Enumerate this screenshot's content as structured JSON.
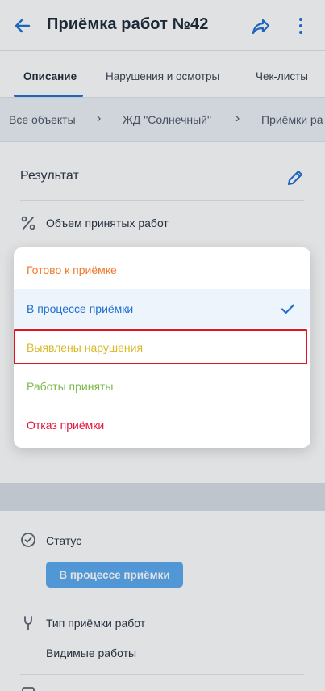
{
  "header": {
    "title": "Приёмка работ №42",
    "icons": {
      "back": "arrow-left-icon",
      "share": "share-icon",
      "more": "more-vertical-icon"
    },
    "accent_color": "#1f6fd1"
  },
  "tabs": [
    {
      "label": "Описание",
      "active": true
    },
    {
      "label": "Нарушения и осмотры",
      "active": false
    },
    {
      "label": "Чек-листы",
      "active": false
    }
  ],
  "breadcrumbs": [
    "Все объекты",
    "ЖД \"Солнечный\"",
    "Приёмки ра"
  ],
  "result_section": {
    "title": "Результат",
    "edit_icon": "pencil-icon",
    "volume_label": "Объем принятых работ",
    "volume_icon": "percent-icon"
  },
  "status_dropdown": {
    "options": [
      {
        "label": "Готово к приёмке",
        "color": "#f07a2e"
      },
      {
        "label": "В процессе приёмки",
        "color": "#1f6fd1",
        "selected": true
      },
      {
        "label": "Выявлены нарушения",
        "color": "#d8b92a",
        "highlighted": true
      },
      {
        "label": "Работы приняты",
        "color": "#7cb94a"
      },
      {
        "label": "Отказ приёмки",
        "color": "#e0163c"
      }
    ],
    "selected_check_icon": "check-icon"
  },
  "details": {
    "status_label": "Статус",
    "status_icon": "check-circle-icon",
    "status_value": "В процессе приёмки",
    "type_label": "Тип приёмки работ",
    "type_icon": "wrench-icon",
    "type_value": "Видимые работы"
  }
}
